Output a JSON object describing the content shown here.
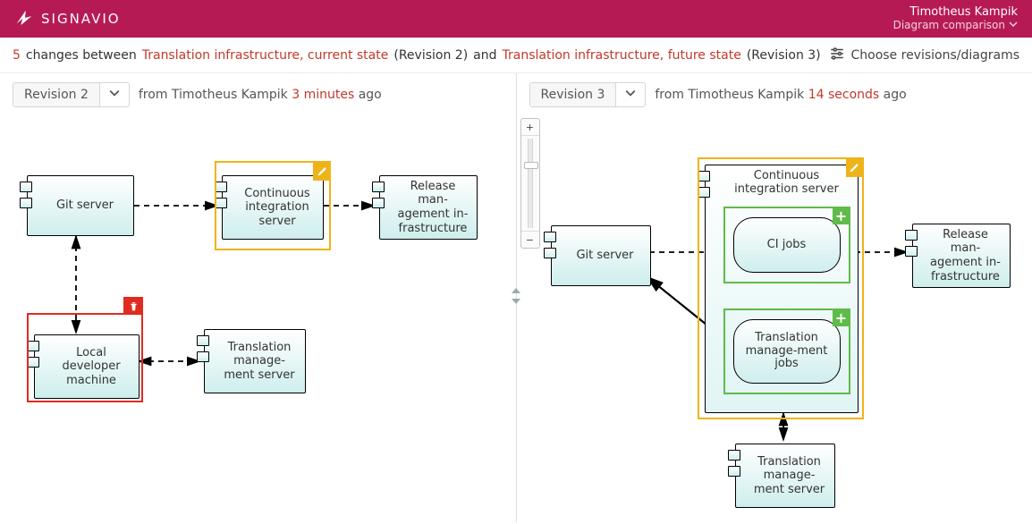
{
  "brand": {
    "name": "SIGNAVIO"
  },
  "user": {
    "name": "Timotheus Kampik",
    "context": "Diagram comparison"
  },
  "summary": {
    "count": "5",
    "changes_word": "changes between",
    "diagram_a": "Translation infrastructure, current state",
    "rev_a": "(Revision 2)",
    "and_word": "and",
    "diagram_b": "Translation infrastructure, future state",
    "rev_b": "(Revision 3)"
  },
  "choose_label": "Choose revisions/diagrams",
  "panes": {
    "left": {
      "rev_label": "Revision 2",
      "from_prefix": "from",
      "author": "Timotheus Kampik",
      "ago": "3 minutes",
      "ago_suffix": "ago",
      "nodes": {
        "git": "Git server",
        "ci": "Continuous integration server",
        "release": "Release man-agement in-frastructure",
        "local": "Local developer machine",
        "tms": "Translation manage-ment server"
      }
    },
    "right": {
      "rev_label": "Revision 3",
      "from_prefix": "from",
      "author": "Timotheus Kampik",
      "ago": "14 seconds",
      "ago_suffix": "ago",
      "nodes": {
        "git": "Git server",
        "pool_title": "Continuous integration server",
        "ci_jobs": "CI jobs",
        "trans_jobs": "Translation manage-ment jobs",
        "release": "Release man-agement in-frastructure",
        "tms": "Translation manage-ment server"
      }
    }
  }
}
